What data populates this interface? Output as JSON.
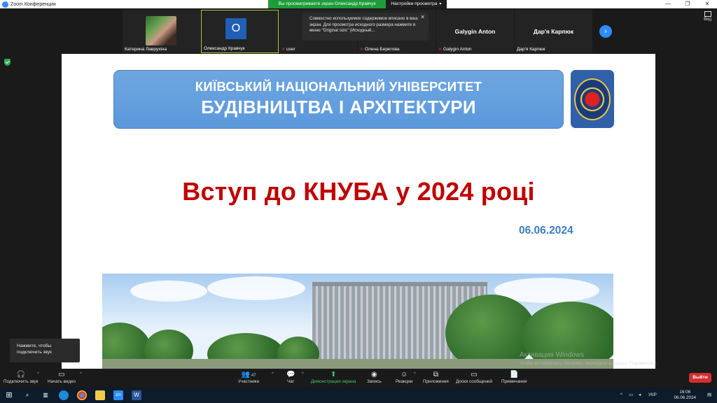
{
  "window": {
    "title": "Zoom Конференция",
    "controls": [
      "—",
      "❐",
      "✕"
    ]
  },
  "share_bar": {
    "status": "Вы просматриваете экран Олександр Кравчук",
    "options": "Настройки просмотра",
    "chevron": "▾"
  },
  "participants": [
    {
      "name": "Катерина Лаврухіна",
      "muted": false,
      "type": "photo"
    },
    {
      "name": "Олександр Кравчук",
      "muted": false,
      "type": "initial",
      "initial": "O",
      "active": true
    },
    {
      "name": "user",
      "muted": true,
      "type": "blank"
    },
    {
      "name": "Олена Берегова",
      "muted": true,
      "type": "blank"
    },
    {
      "name": "Galygin Anton",
      "muted": true,
      "type": "name",
      "big_name": "Galygin Anton"
    },
    {
      "name": "Дар'я Карпюк",
      "muted": false,
      "type": "name",
      "big_name": "Дар'я Карпюк"
    }
  ],
  "view_button": {
    "label": "Вид"
  },
  "tooltip": {
    "text": "Совместно используемое содержимое вписано в ваш экран. Для просмотра исходного размера нажмите в меню \"Original size\" (Исходный...",
    "close": "✕"
  },
  "slide": {
    "banner_line1": "КИЇВСЬКИЙ НАЦІОНАЛЬНИЙ УНІВЕРСИТЕТ",
    "banner_line2": "БУДІВНИЦТВА І АРХІТЕКТУРИ",
    "title": "Вступ до КНУБА у 2024 році",
    "date": "06.06.2024",
    "colors": {
      "title": "#c00000",
      "date": "#3b7dc4",
      "banner": "#5b98dc"
    }
  },
  "watermark": {
    "line1": "Активация Windows",
    "line2": "Чтобы активировать Windows, перейдите в раздел \"Параметры\"."
  },
  "unmute_tip": {
    "text": "Нажмите, чтобы подключить звук"
  },
  "toolbar": {
    "audio": "Подключить звук",
    "video": "Начать видео",
    "participants": "Участники",
    "participants_count": "47",
    "chat": "Чат",
    "share": "Демонстрация экрана",
    "record": "Запись",
    "reactions": "Реакции",
    "apps": "Приложения",
    "whiteboards": "Доски сообщений",
    "notes": "Примечания",
    "leave": "Выйти"
  },
  "taskbar": {
    "language": "УКР",
    "time": "16:06",
    "date": "06.06.2024"
  }
}
